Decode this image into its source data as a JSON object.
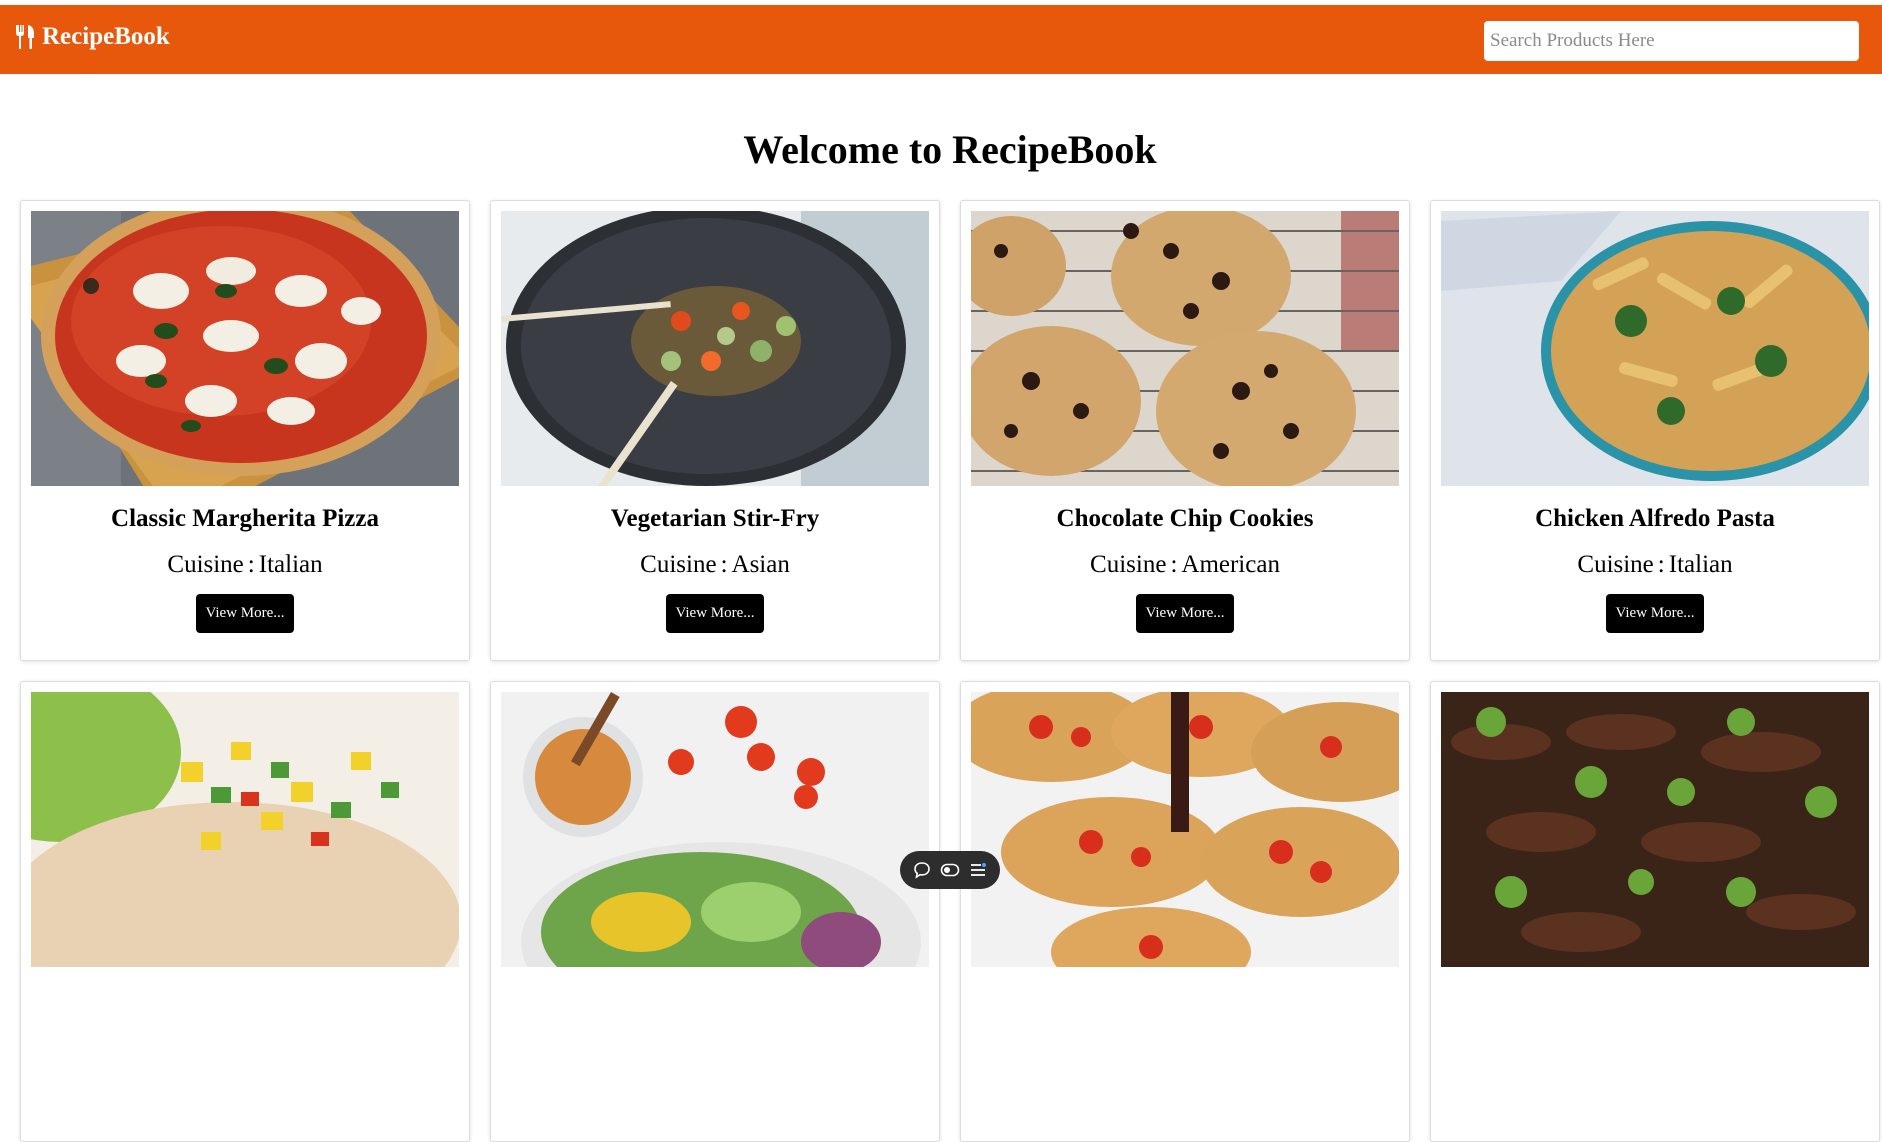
{
  "header": {
    "brand": "RecipeBook",
    "brand_icon": "utensils-icon",
    "search_placeholder": "Search Products Here",
    "accent_color": "#e8580c"
  },
  "main": {
    "welcome_title": "Welcome to RecipeBook"
  },
  "recipes": [
    {
      "title": "Classic Margherita Pizza",
      "cuisine_label": "Cuisine",
      "cuisine": "Italian",
      "button": "View More...",
      "image": "margherita-pizza-photo"
    },
    {
      "title": "Vegetarian Stir-Fry",
      "cuisine_label": "Cuisine",
      "cuisine": "Asian",
      "button": "View More...",
      "image": "stir-fry-photo"
    },
    {
      "title": "Chocolate Chip Cookies",
      "cuisine_label": "Cuisine",
      "cuisine": "American",
      "button": "View More...",
      "image": "cookies-photo"
    },
    {
      "title": "Chicken Alfredo Pasta",
      "cuisine_label": "Cuisine",
      "cuisine": "Italian",
      "button": "View More...",
      "image": "alfredo-pasta-photo"
    },
    {
      "image": "grilled-chicken-salsa-photo"
    },
    {
      "image": "salad-bowl-photo"
    },
    {
      "image": "bruschetta-photo"
    },
    {
      "image": "beef-broccoli-photo"
    }
  ],
  "floating_toolbar": {
    "icons": [
      "chat-icon",
      "toggle-icon",
      "list-icon"
    ]
  }
}
